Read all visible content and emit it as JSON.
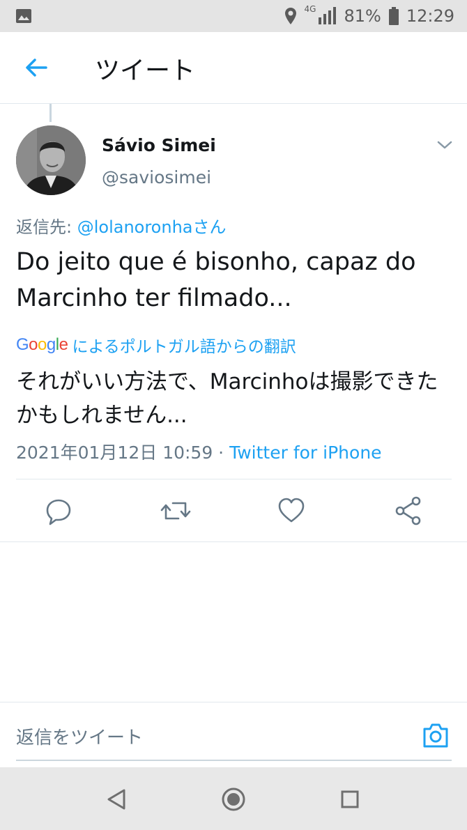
{
  "status_bar": {
    "network": "4G",
    "battery": "81%",
    "time": "12:29"
  },
  "header": {
    "title": "ツイート"
  },
  "tweet": {
    "author_name": "Sávio Simei",
    "author_handle": "@saviosimei",
    "replying_prefix": "返信先: ",
    "replying_to": "@lolanoronhaさん",
    "text": "Do jeito que é bisonho, capaz do Marcinho ter filmado...",
    "translation_label": "によるポルトガル語からの翻訳",
    "translation_brand": "Google",
    "translated_text": "それがいい方法で、Marcinhoは撮影できたかもしれません...",
    "timestamp": "2021年01月12日 10:59 · ",
    "source": "Twitter for iPhone"
  },
  "reply_box": {
    "placeholder": "返信をツイート"
  },
  "colors": {
    "accent": "#1da1f2",
    "secondary_text": "#657786",
    "divider": "#e1e8ed"
  },
  "icons": [
    "image-icon",
    "location-icon",
    "signal-icon",
    "battery-icon",
    "back-arrow-icon",
    "chevron-down-icon",
    "reply-icon",
    "retweet-icon",
    "like-icon",
    "share-icon",
    "camera-icon",
    "nav-back-icon",
    "nav-home-icon",
    "nav-recents-icon"
  ]
}
